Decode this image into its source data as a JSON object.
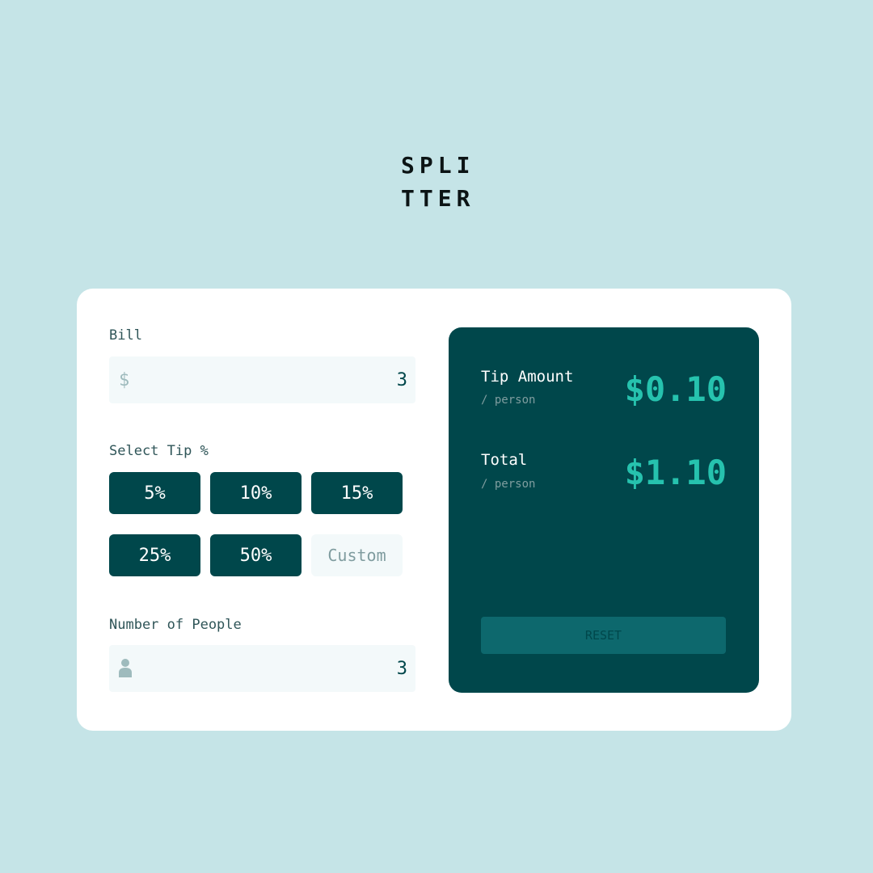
{
  "logo": {
    "line1": "SPLI",
    "line2": "TTER"
  },
  "bill": {
    "label": "Bill",
    "icon": "dollar-icon",
    "icon_glyph": "$",
    "value": "3"
  },
  "tip": {
    "label": "Select Tip %",
    "options": [
      "5%",
      "10%",
      "15%",
      "25%",
      "50%"
    ],
    "custom_placeholder": "Custom"
  },
  "people": {
    "label": "Number of People",
    "icon": "person-icon",
    "value": "3"
  },
  "results": {
    "tip_amount_label": "Tip Amount",
    "tip_amount_sub": "/ person",
    "tip_amount_value": "$0.10",
    "total_label": "Total",
    "total_sub": "/ person",
    "total_value": "$1.10",
    "reset_label": "RESET"
  },
  "colors": {
    "background": "#c5e4e7",
    "card": "#ffffff",
    "dark_teal": "#00474b",
    "accent": "#26c2ae",
    "input_bg": "#f3f9fa",
    "reset_bg": "#0d686d"
  }
}
